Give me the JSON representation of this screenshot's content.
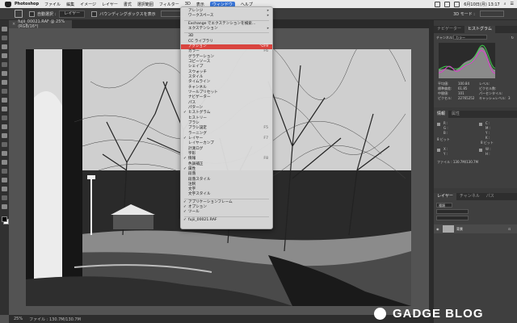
{
  "menubar": {
    "app": "Photoshop",
    "items": [
      "ファイル",
      "編集",
      "イメージ",
      "レイヤー",
      "書式",
      "選択範囲",
      "フィルター",
      "3D",
      "表示",
      "ウィンドウ",
      "ヘルプ"
    ],
    "active_index": 9,
    "clock": "6月10日(月) 13:17"
  },
  "optbar": {
    "auto_select_label": "自動選択 :",
    "auto_select_value": "レイヤー",
    "transform_label": "バウンディングボックスを表示",
    "mode_label": "3D モード :"
  },
  "document": {
    "tab_title": "fujii_00021.RAF @ 25% (RGB/16*)"
  },
  "window_menu": {
    "items": [
      {
        "label": "アレンジ",
        "type": "submenu"
      },
      {
        "label": "ワークスペース",
        "type": "submenu"
      },
      {
        "type": "sep"
      },
      {
        "label": "Exchange でエクステンションを検索...",
        "type": "item"
      },
      {
        "label": "エクステンション",
        "type": "submenu"
      },
      {
        "type": "sep"
      },
      {
        "label": "3D",
        "type": "item"
      },
      {
        "label": "CC ライブラリ",
        "type": "item"
      },
      {
        "label": "アクション",
        "type": "item",
        "shortcut": "⌥F9",
        "selected": true
      },
      {
        "label": "カラー",
        "type": "item",
        "shortcut": "F6"
      },
      {
        "label": "グラデーション",
        "type": "item"
      },
      {
        "label": "コピーソース",
        "type": "item"
      },
      {
        "label": "シェイプ",
        "type": "item"
      },
      {
        "label": "スウォッチ",
        "type": "item"
      },
      {
        "label": "スタイル",
        "type": "item"
      },
      {
        "label": "タイムライン",
        "type": "item"
      },
      {
        "label": "チャンネル",
        "type": "item"
      },
      {
        "label": "ツールプリセット",
        "type": "item"
      },
      {
        "label": "ナビゲーター",
        "type": "item"
      },
      {
        "label": "パス",
        "type": "item"
      },
      {
        "label": "パターン",
        "type": "item"
      },
      {
        "label": "ヒストグラム",
        "type": "item",
        "checked": true
      },
      {
        "label": "ヒストリー",
        "type": "item"
      },
      {
        "label": "ブラシ",
        "type": "item"
      },
      {
        "label": "ブラシ設定",
        "type": "item",
        "shortcut": "F5"
      },
      {
        "label": "ラーニング",
        "type": "item"
      },
      {
        "label": "レイヤー",
        "type": "item",
        "shortcut": "F7",
        "checked": true
      },
      {
        "label": "レイヤーカンプ",
        "type": "item"
      },
      {
        "label": "計測ログ",
        "type": "item"
      },
      {
        "label": "字形",
        "type": "item"
      },
      {
        "label": "情報",
        "type": "item",
        "shortcut": "F8",
        "checked": true
      },
      {
        "label": "色調補正",
        "type": "item"
      },
      {
        "label": "属性",
        "type": "item",
        "checked": true
      },
      {
        "label": "段落",
        "type": "item"
      },
      {
        "label": "段落スタイル",
        "type": "item"
      },
      {
        "label": "注釈",
        "type": "item"
      },
      {
        "label": "文字",
        "type": "item"
      },
      {
        "label": "文字スタイル",
        "type": "item"
      },
      {
        "type": "sep"
      },
      {
        "label": "アプリケーションフレーム",
        "type": "item",
        "checked": true
      },
      {
        "label": "オプション",
        "type": "item",
        "checked": true
      },
      {
        "label": "ツール",
        "type": "item",
        "checked": true
      },
      {
        "type": "sep"
      },
      {
        "label": "fujii_00021.RAF",
        "type": "item",
        "checked": true
      }
    ]
  },
  "histogram_panel": {
    "tabs": [
      "ナビゲーター",
      "ヒストグラム"
    ],
    "active_tab": 1,
    "channel_label": "チャンネル:",
    "channel_value": "カラー",
    "stats_left": [
      "平均値:",
      "標準偏差:",
      "中間値:",
      "ピクセル:"
    ],
    "stats_left_values": [
      "100.84",
      "61.85",
      "101",
      "22765252"
    ],
    "stats_right": [
      "レベル:",
      "ピクセル数:",
      "パーセンタイル:",
      "キャッシュレベル:"
    ],
    "stats_right_values": [
      "",
      "",
      "",
      "3"
    ]
  },
  "info_panel": {
    "tabs": [
      "情報",
      "属性"
    ],
    "rgb_labels": [
      "R :",
      "G :",
      "B :"
    ],
    "cmyk_labels": [
      "C :",
      "M :",
      "Y :",
      "K :"
    ],
    "bits_left": "8 ビット",
    "bits_right": "8 ビット",
    "x_label": "X :",
    "y_label": "Y :",
    "w_label": "W :",
    "h_label": "H :",
    "file_label": "ファイル : 130.7M/130.7M"
  },
  "layers_panel": {
    "tabs": [
      "レイヤー",
      "チャンネル",
      "パス"
    ],
    "search_placeholder": "種類",
    "layer_name": "背景"
  },
  "statusbar": {
    "zoom": "25%",
    "file": "ファイル : 130.7M/130.7M"
  },
  "watermark": {
    "brand": "GADGE BLOG"
  },
  "colors": {
    "menu_highlight": "#d9443f",
    "panel_bg": "#3f3f3f",
    "histogram_green": "#3ccf4a",
    "histogram_magenta": "#e03ad0"
  }
}
